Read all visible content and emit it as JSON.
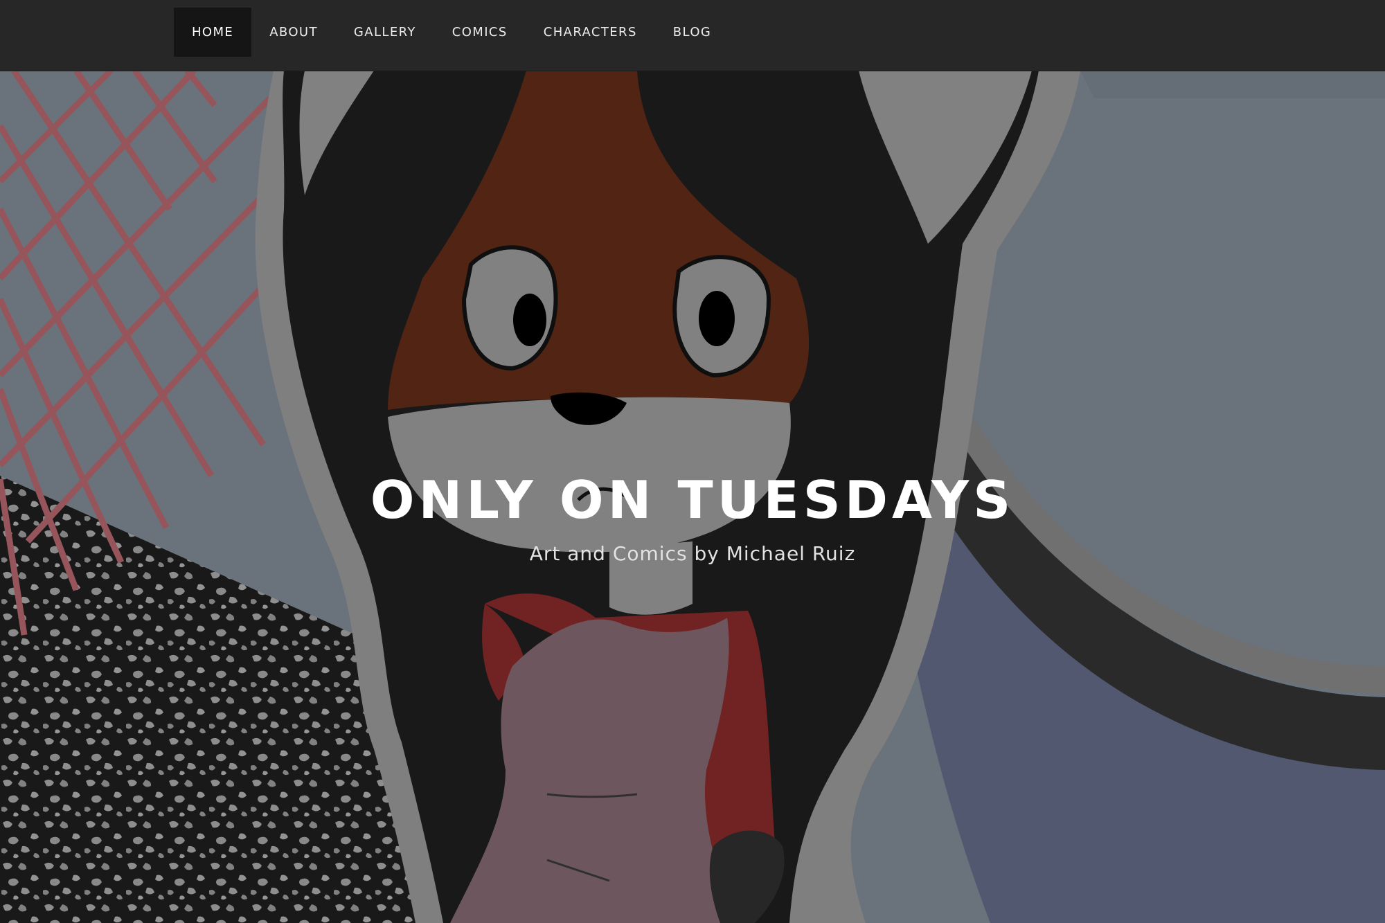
{
  "nav": {
    "items": [
      {
        "label": "HOME",
        "active": true
      },
      {
        "label": "ABOUT",
        "active": false
      },
      {
        "label": "GALLERY",
        "active": false
      },
      {
        "label": "COMICS",
        "active": false
      },
      {
        "label": "CHARACTERS",
        "active": false
      },
      {
        "label": "BLOG",
        "active": false
      }
    ]
  },
  "hero": {
    "title": "ONLY ON TUESDAYS",
    "tagline": "Art and Comics by Michael Ruiz"
  },
  "colors": {
    "navbar_bg": "#272727",
    "nav_active_bg": "#151515",
    "hero_bg": "#727c86",
    "title_text": "#ffffff"
  }
}
